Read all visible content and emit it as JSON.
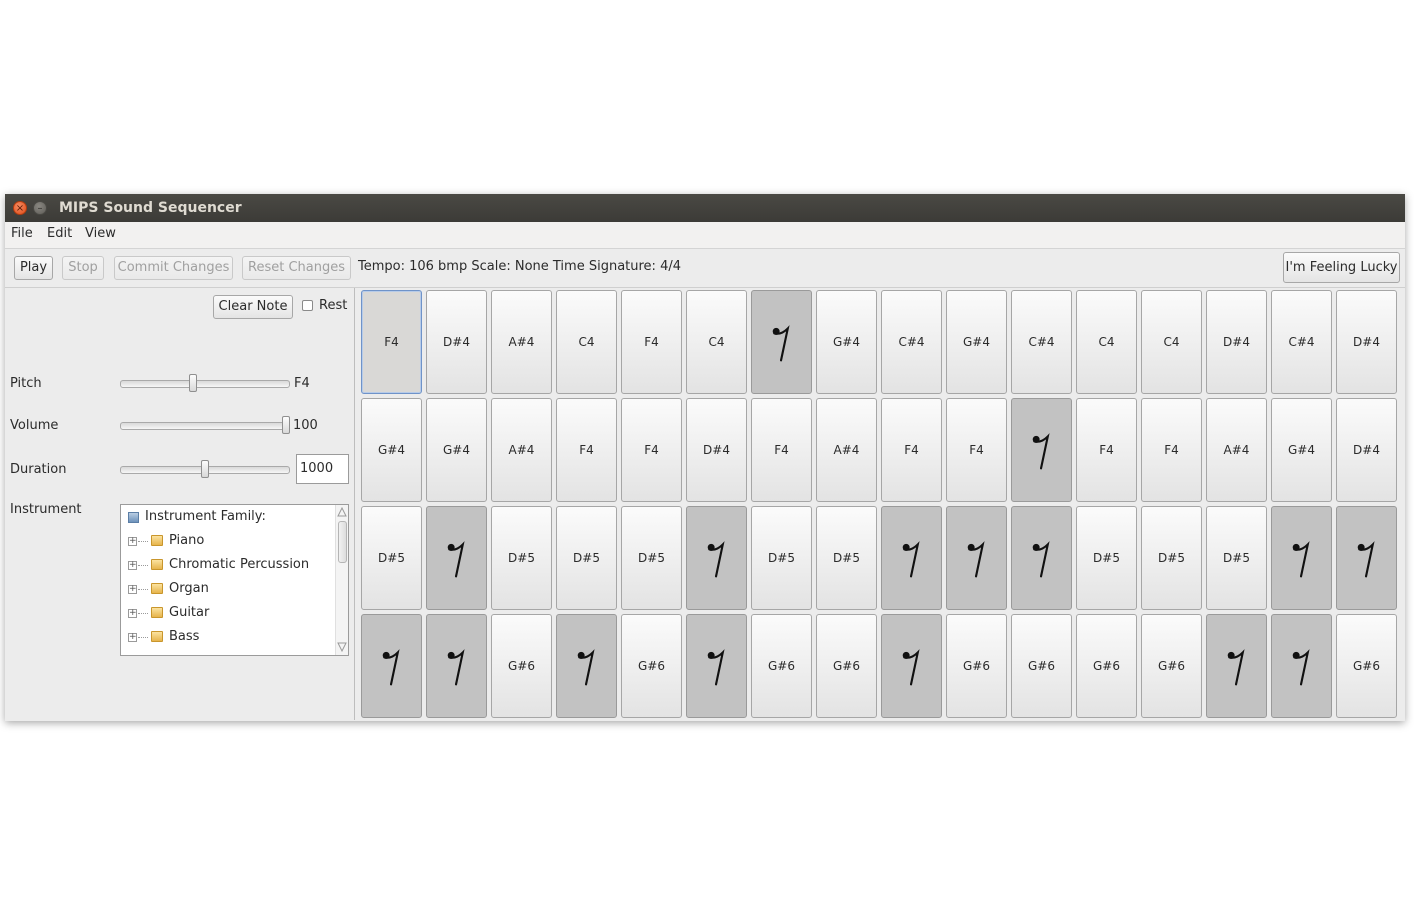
{
  "window": {
    "title": "MIPS Sound Sequencer",
    "close_glyph": "×",
    "minimize_glyph": "–"
  },
  "menu": [
    {
      "label": "File"
    },
    {
      "label": "Edit"
    },
    {
      "label": "View"
    }
  ],
  "toolbar": {
    "play_label": "Play",
    "stop_label": "Stop",
    "commit_label": "Commit Changes",
    "reset_label": "Reset Changes",
    "status": "Tempo: 106 bmp Scale: None Time Signature: 4/4",
    "lucky_label": "I'm Feeling Lucky"
  },
  "editor": {
    "clear_note_label": "Clear Note",
    "rest_label": "Rest",
    "rest_checked": false,
    "pitch_label": "Pitch",
    "pitch_value": "F4",
    "pitch_fraction": 0.43,
    "volume_label": "Volume",
    "volume_value": "100",
    "volume_fraction": 1.0,
    "duration_label": "Duration",
    "duration_value": "1000",
    "duration_fraction": 0.5,
    "instrument_label": "Instrument"
  },
  "instrument_tree": {
    "root": "Instrument Family:",
    "families": [
      "Piano",
      "Chromatic Percussion",
      "Organ",
      "Guitar",
      "Bass"
    ],
    "expander_glyph": "+"
  },
  "grid": {
    "selected": [
      0,
      0
    ],
    "rows": [
      [
        "F4",
        "D#4",
        "A#4",
        "C4",
        "F4",
        "C4",
        "REST",
        "G#4",
        "C#4",
        "G#4",
        "C#4",
        "C4",
        "C4",
        "D#4",
        "C#4",
        "D#4"
      ],
      [
        "G#4",
        "G#4",
        "A#4",
        "F4",
        "F4",
        "D#4",
        "F4",
        "A#4",
        "F4",
        "F4",
        "REST",
        "F4",
        "F4",
        "A#4",
        "G#4",
        "D#4"
      ],
      [
        "D#5",
        "REST",
        "D#5",
        "D#5",
        "D#5",
        "REST",
        "D#5",
        "D#5",
        "REST",
        "REST",
        "REST",
        "D#5",
        "D#5",
        "D#5",
        "REST",
        "REST"
      ],
      [
        "REST",
        "REST",
        "G#6",
        "REST",
        "G#6",
        "REST",
        "G#6",
        "G#6",
        "REST",
        "G#6",
        "G#6",
        "G#6",
        "G#6",
        "REST",
        "REST",
        "G#6"
      ]
    ]
  }
}
